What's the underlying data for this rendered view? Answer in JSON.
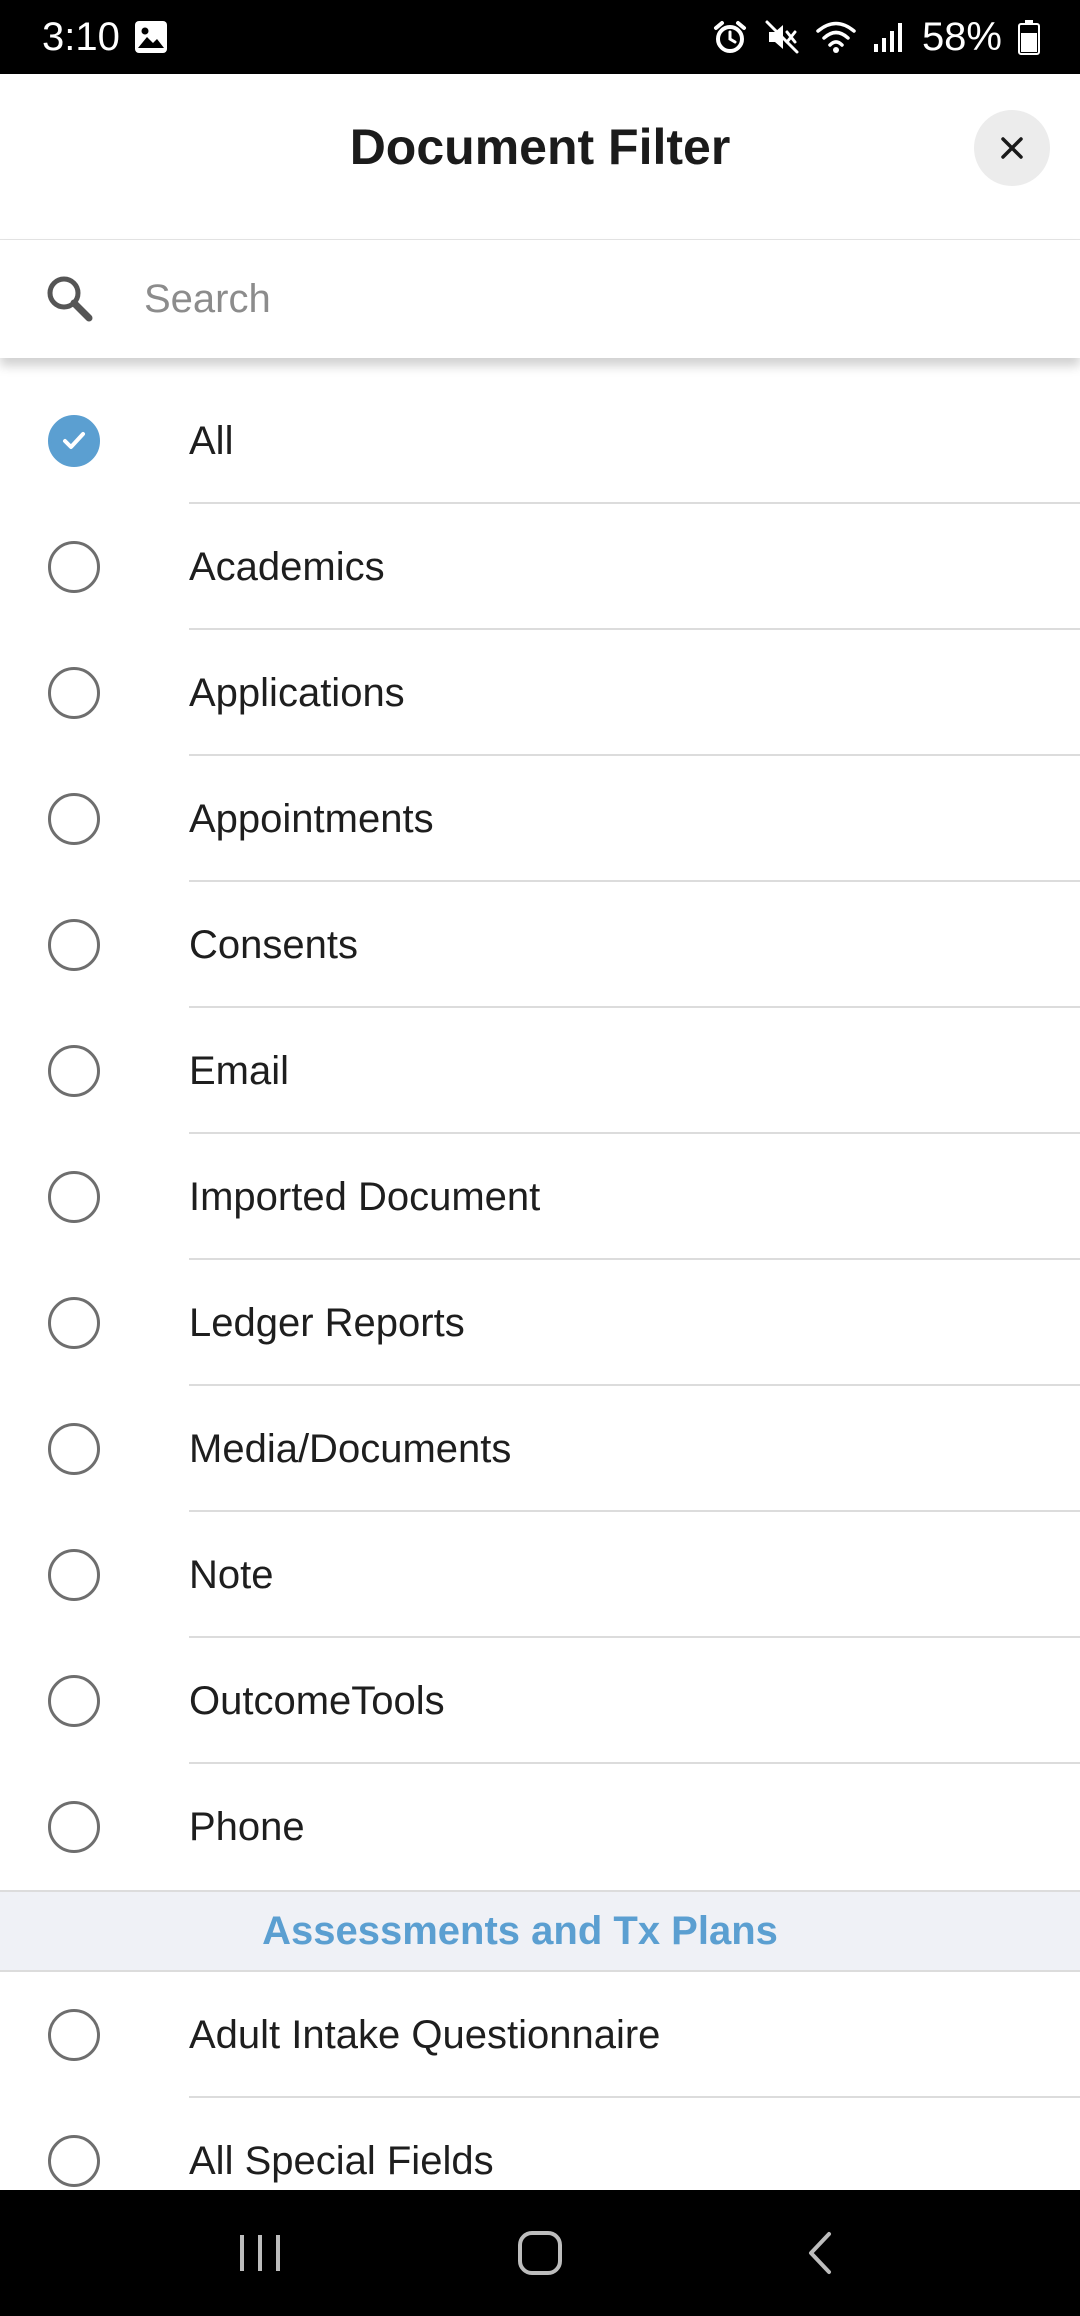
{
  "status_bar": {
    "time": "3:10",
    "battery": "58%",
    "icons": [
      "image-icon",
      "alarm-icon",
      "mute-icon",
      "wifi-icon",
      "signal-icon",
      "battery-icon"
    ]
  },
  "header": {
    "title": "Document Filter",
    "close_icon": "close-icon"
  },
  "search": {
    "placeholder": "Search",
    "value": "",
    "icon": "search-icon"
  },
  "filters": {
    "items": [
      {
        "label": "All",
        "checked": true
      },
      {
        "label": "Academics",
        "checked": false
      },
      {
        "label": "Applications",
        "checked": false
      },
      {
        "label": "Appointments",
        "checked": false
      },
      {
        "label": "Consents",
        "checked": false
      },
      {
        "label": "Email",
        "checked": false
      },
      {
        "label": "Imported Document",
        "checked": false
      },
      {
        "label": "Ledger Reports",
        "checked": false
      },
      {
        "label": "Media/Documents",
        "checked": false
      },
      {
        "label": "Note",
        "checked": false
      },
      {
        "label": "OutcomeTools",
        "checked": false
      },
      {
        "label": "Phone",
        "checked": false
      }
    ]
  },
  "assessments": {
    "section_title": "Assessments and Tx Plans",
    "items": [
      {
        "label": "Adult Intake Questionnaire",
        "checked": false
      },
      {
        "label": "All Special Fields",
        "checked": false
      }
    ]
  },
  "nav_bar": {
    "buttons": [
      "recent-apps-icon",
      "home-icon",
      "back-icon"
    ]
  },
  "colors": {
    "accent": "#5b9fd1",
    "section_bg": "#eff1f6",
    "radio_border": "#6e6e6e",
    "divider": "#dcdcdc"
  }
}
